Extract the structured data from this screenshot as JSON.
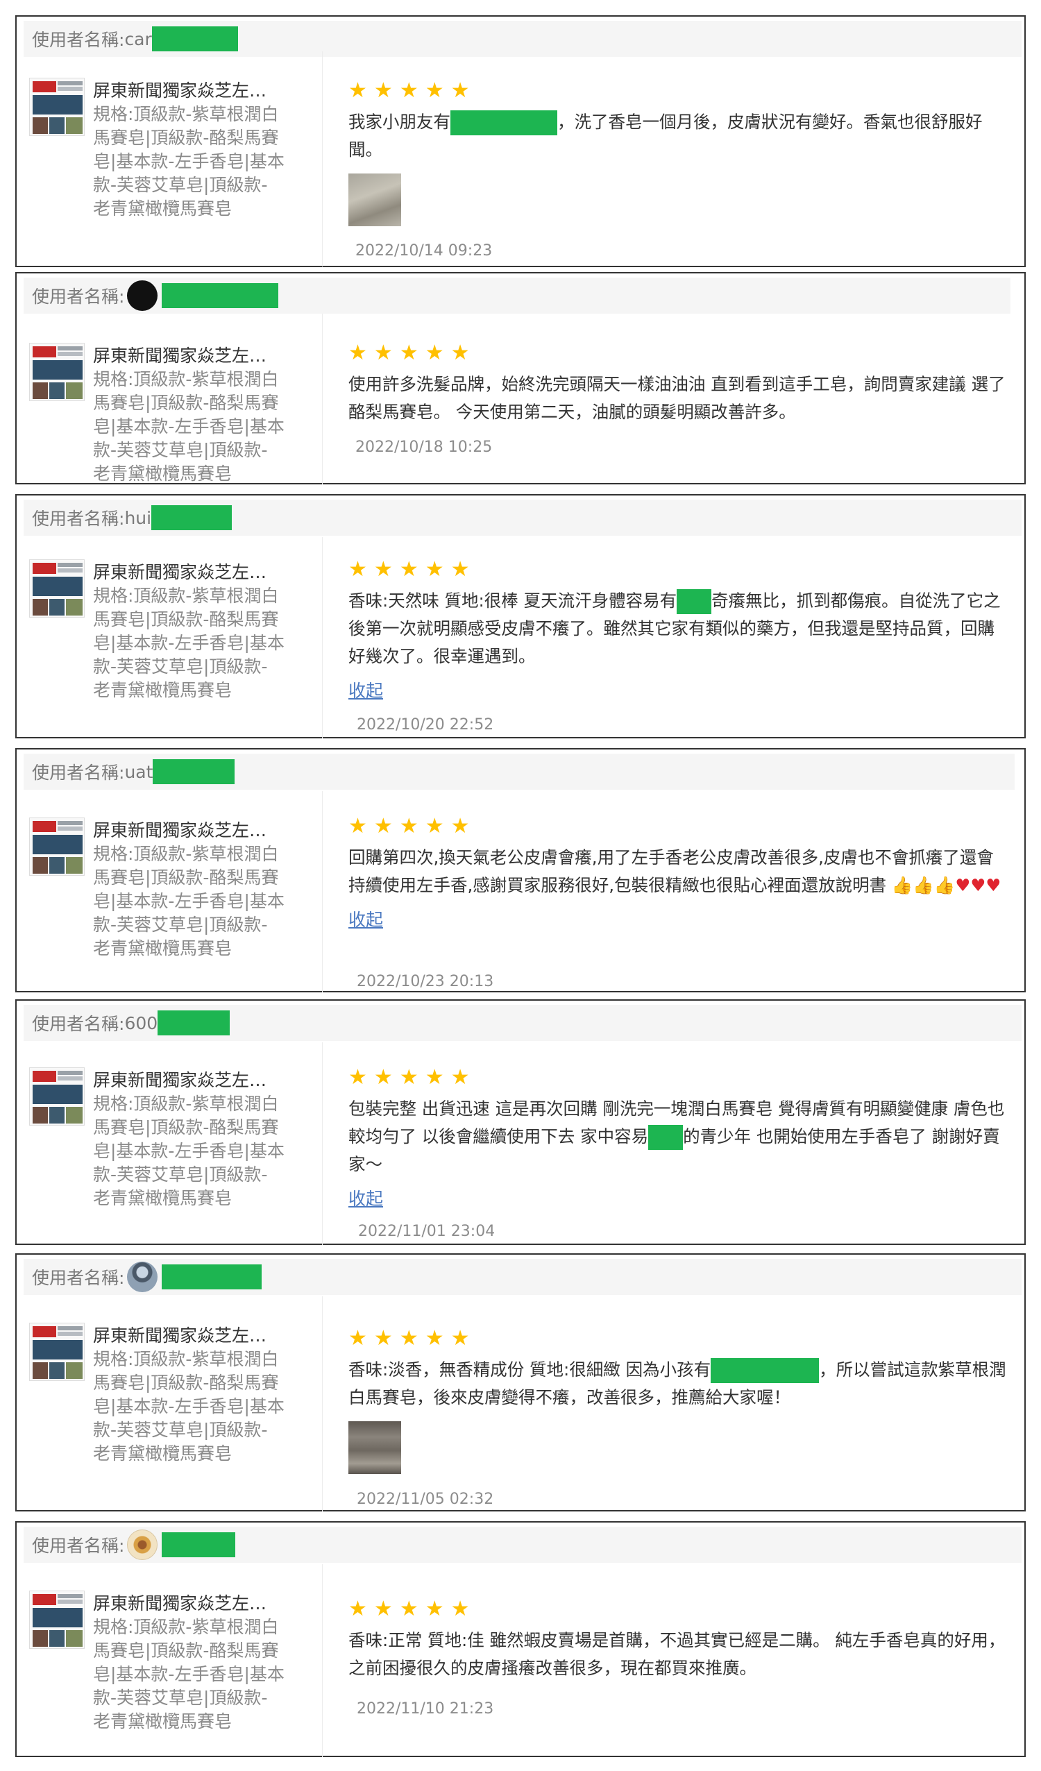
{
  "colors": {
    "star": "#ffc000",
    "redaction": "#1db551",
    "link": "#4a78c0"
  },
  "common": {
    "username_label": "使用者名稱:",
    "product_name": "屏東新聞獨家焱芝左…",
    "product_spec": "規格:頂級款-紫草根潤白馬賽皂|頂級款-酪梨馬賽皂|基本款-左手香皂|基本款-芙蓉艾草皂|頂級款-老青黛橄欖馬賽皂",
    "product_spec_lines": [
      "規格:頂級款-紫草根潤白",
      "馬賽皂|頂級款-酪梨馬賽",
      "皂|基本款-左手香皂|基本",
      "款-芙蓉艾草皂|頂級款-",
      "老青黛橄欖馬賽皂"
    ],
    "collapse_label": "收起",
    "rating": 5
  },
  "reviews": [
    {
      "username_prefix": "car",
      "avatar": "none",
      "text_a": "我家小朋友有",
      "text_b": "，洗了香皂一個月後，皮膚狀況有變好。香氣也很舒服好聞。",
      "date": "2022/10/14 09:23",
      "has_photo": true
    },
    {
      "username_prefix": "",
      "avatar": "dark",
      "text_a": "使用許多洗髮品牌，始終洗完頭隔天一樣油油油 直到看到這手工皂，詢問賣家建議 選了酪梨馬賽皂。 今天使用第二天，油膩的頭髮明顯改善許多。",
      "text_b": "",
      "date": "2022/10/18 10:25",
      "has_photo": false
    },
    {
      "username_prefix": "hui",
      "avatar": "none",
      "text_a": "香味:天然味 質地:很棒 夏天流汗身體容易有",
      "text_b": "奇癢無比，抓到都傷痕。自從洗了它之後第一次就明顯感受皮膚不癢了。雖然其它家有類似的藥方，但我還是堅持品質，回購好幾次了。很幸運遇到。",
      "date": "2022/10/20 22:52",
      "has_photo": false
    },
    {
      "username_prefix": "uat",
      "avatar": "none",
      "text_a": "回購第四次,換天氣老公皮膚會癢,用了左手香老公皮膚改善很多,皮膚也不會抓癢了還會持續使用左手香,感謝買家服務很好,包裝很精緻也很貼心裡面還放說明書",
      "text_b": "",
      "date": "2022/10/23 20:13",
      "has_photo": false
    },
    {
      "username_prefix": "600",
      "avatar": "none",
      "text_a": "包裝完整 出貨迅速 這是再次回購 剛洗完一塊潤白馬賽皂 覺得膚質有明顯變健康 膚色也較均勻了 以後會繼續使用下去 家中容易",
      "text_b": "的青少年 也開始使用左手香皂了 謝謝好賣家～",
      "date": "2022/11/01 23:04",
      "has_photo": false
    },
    {
      "username_prefix": "",
      "avatar": "photo",
      "text_a": "香味:淡香，無香精成份 質地:很細緻 因為小孩有",
      "text_b": "，所以嘗試這款紫草根潤白馬賽皂，後來皮膚變得不癢，改善很多，推薦給大家喔！",
      "date": "2022/11/05 02:32",
      "has_photo": true
    },
    {
      "username_prefix": "",
      "avatar": "dish",
      "text_a": "香味:正常 質地:佳 雖然蝦皮賣場是首購，不過其實已經是二購。 純左手香皂真的好用，之前困擾很久的皮膚搔癢改善很多，現在都買來推廣。",
      "text_b": "",
      "date": "2022/11/10 21:23",
      "has_photo": false
    }
  ]
}
